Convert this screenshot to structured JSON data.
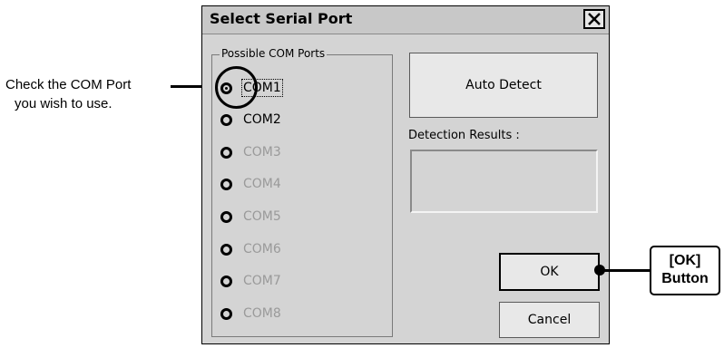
{
  "dialog": {
    "title": "Select Serial Port",
    "close_icon": "close-icon"
  },
  "group": {
    "legend": "Possible COM Ports",
    "ports": [
      {
        "label": "COM1",
        "checked": true,
        "enabled": true
      },
      {
        "label": "COM2",
        "checked": false,
        "enabled": true
      },
      {
        "label": "COM3",
        "checked": false,
        "enabled": false
      },
      {
        "label": "COM4",
        "checked": false,
        "enabled": false
      },
      {
        "label": "COM5",
        "checked": false,
        "enabled": false
      },
      {
        "label": "COM6",
        "checked": false,
        "enabled": false
      },
      {
        "label": "COM7",
        "checked": false,
        "enabled": false
      },
      {
        "label": "COM8",
        "checked": false,
        "enabled": false
      }
    ]
  },
  "buttons": {
    "auto_detect": "Auto Detect",
    "ok": "OK",
    "cancel": "Cancel"
  },
  "detection": {
    "label": "Detection Results :",
    "value": ""
  },
  "annotations": {
    "left_line1": "Check the COM Port",
    "left_line2": "you wish to use.",
    "right_line1": "[OK]",
    "right_line2": "Button"
  }
}
